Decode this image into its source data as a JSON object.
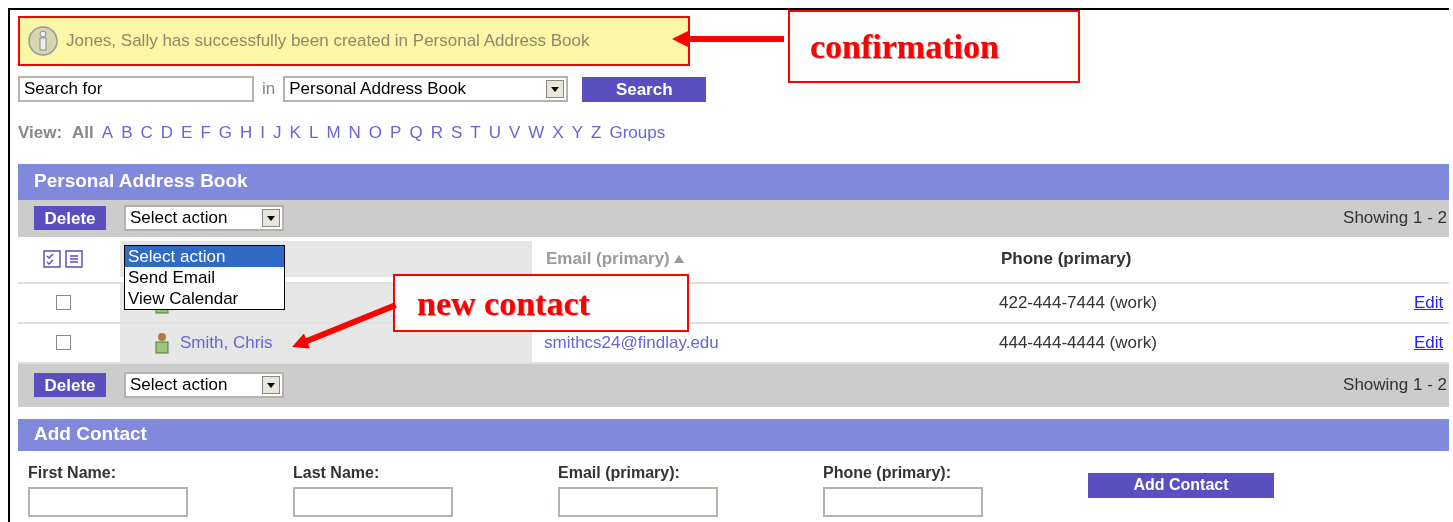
{
  "confirmation": {
    "message": "Jones, Sally has successfully been created in Personal Address Book"
  },
  "search": {
    "value": "Search for",
    "in_label": "in",
    "scope": "Personal Address Book",
    "button": "Search"
  },
  "view": {
    "label": "View:",
    "items": [
      {
        "label": "All",
        "selected": true
      },
      {
        "label": "A",
        "selected": false
      },
      {
        "label": "B",
        "selected": false
      },
      {
        "label": "C",
        "selected": false
      },
      {
        "label": "D",
        "selected": false
      },
      {
        "label": "E",
        "selected": false
      },
      {
        "label": "F",
        "selected": false
      },
      {
        "label": "G",
        "selected": false
      },
      {
        "label": "H",
        "selected": false
      },
      {
        "label": "I",
        "selected": false
      },
      {
        "label": "J",
        "selected": false
      },
      {
        "label": "K",
        "selected": false
      },
      {
        "label": "L",
        "selected": false
      },
      {
        "label": "M",
        "selected": false
      },
      {
        "label": "N",
        "selected": false
      },
      {
        "label": "O",
        "selected": false
      },
      {
        "label": "P",
        "selected": false
      },
      {
        "label": "Q",
        "selected": false
      },
      {
        "label": "R",
        "selected": false
      },
      {
        "label": "S",
        "selected": false
      },
      {
        "label": "T",
        "selected": false
      },
      {
        "label": "U",
        "selected": false
      },
      {
        "label": "V",
        "selected": false
      },
      {
        "label": "W",
        "selected": false
      },
      {
        "label": "X",
        "selected": false
      },
      {
        "label": "Y",
        "selected": false
      },
      {
        "label": "Z",
        "selected": false
      },
      {
        "label": "Groups",
        "selected": false
      }
    ]
  },
  "address_book": {
    "title": "Personal Address Book",
    "toolbars": [
      {
        "delete_button": "Delete",
        "action_select": "Select action",
        "showing": "Showing 1 - 2"
      },
      {
        "delete_button": "Delete",
        "action_select": "Select action",
        "showing": "Showing 1 - 2"
      }
    ],
    "action_menu": [
      {
        "label": "Select action",
        "selected": true
      },
      {
        "label": "Send Email",
        "selected": false
      },
      {
        "label": "View Calendar",
        "selected": false
      }
    ],
    "columns": [
      "Email (primary)",
      "Phone (primary)"
    ],
    "rows": [
      {
        "checked": false,
        "phone": "422-444-7444 (work)",
        "action": "Edit"
      },
      {
        "checked": false,
        "name": "Smith, Chris",
        "email": "smithcs24@findlay.edu",
        "phone": "444-444-4444 (work)",
        "action": "Edit"
      }
    ]
  },
  "add_contact": {
    "title": "Add Contact",
    "fields": [
      {
        "label": "First Name:"
      },
      {
        "label": "Last Name:"
      },
      {
        "label": "Email (primary):"
      },
      {
        "label": "Phone (primary):"
      }
    ],
    "button": "Add Contact"
  },
  "annotations": [
    {
      "text": "confirmation"
    },
    {
      "text": "new contact"
    }
  ]
}
